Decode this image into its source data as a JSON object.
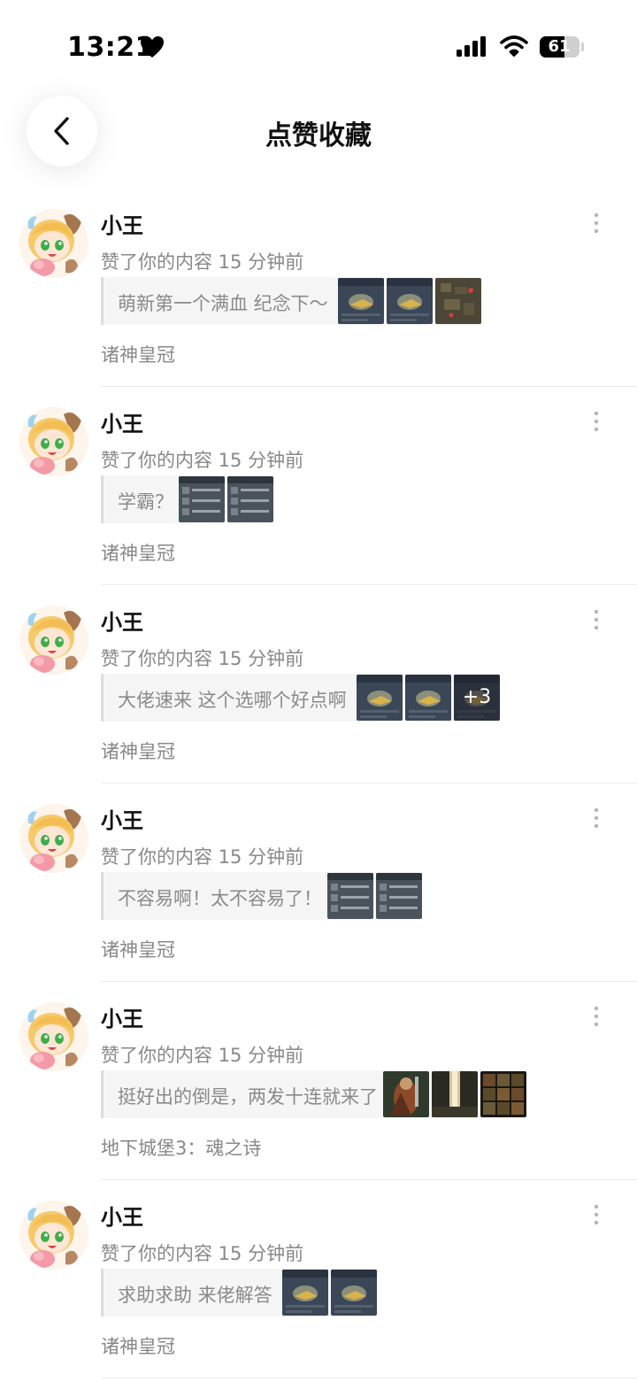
{
  "status_bar": {
    "time": "13:21",
    "battery": "61"
  },
  "header": {
    "title": "点赞收藏"
  },
  "colors": {
    "accent_text": "#111111",
    "muted_text": "#888888",
    "quote_bg": "#f5f5f5"
  },
  "notifications": [
    {
      "user": "小王",
      "action": "赞了你的内容 15 分钟前",
      "content": "萌新第一个满血 纪念下～",
      "images": [
        "dark-ui",
        "dark-ui",
        "map"
      ],
      "more": "",
      "game": "诸神皇冠"
    },
    {
      "user": "小王",
      "action": "赞了你的内容 15 分钟前",
      "content": "学霸？",
      "images": [
        "list-ui",
        "list-ui"
      ],
      "more": "",
      "game": "诸神皇冠"
    },
    {
      "user": "小王",
      "action": "赞了你的内容 15 分钟前",
      "content": "大佬速来 这个选哪个好点啊",
      "images": [
        "dark-ui",
        "dark-ui",
        "dark-ui"
      ],
      "more": "+3",
      "game": "诸神皇冠"
    },
    {
      "user": "小王",
      "action": "赞了你的内容 15 分钟前",
      "content": "不容易啊！太不容易了！",
      "images": [
        "list-ui",
        "list-ui"
      ],
      "more": "",
      "game": "诸神皇冠"
    },
    {
      "user": "小王",
      "action": "赞了你的内容 15 分钟前",
      "content": "挺好出的倒是，两发十连就来了",
      "images": [
        "warrior",
        "light",
        "grid"
      ],
      "more": "",
      "game": "地下城堡3：魂之诗"
    },
    {
      "user": "小王",
      "action": "赞了你的内容 15 分钟前",
      "content": "求助求助 来佬解答",
      "images": [
        "dark-ui",
        "dark-ui"
      ],
      "more": "",
      "game": "诸神皇冠"
    }
  ]
}
